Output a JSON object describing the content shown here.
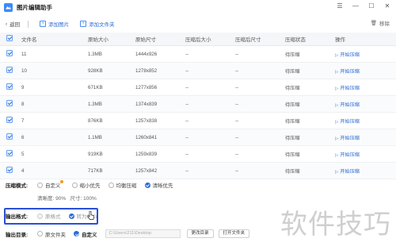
{
  "window": {
    "title": "图片编辑助手",
    "controls": [
      "☰",
      "—",
      "☐",
      "✕"
    ]
  },
  "toolbar": {
    "back_label": "返回",
    "add_image_label": "添加图片",
    "add_folder_label": "添加文件夹",
    "delete_label": "移除"
  },
  "table": {
    "headers": [
      "文件名",
      "原始大小",
      "原始尺寸",
      "压缩后大小",
      "压缩后尺寸",
      "压缩状态",
      "操作"
    ],
    "rows": [
      {
        "name": "11",
        "orig_size": "1.3MB",
        "orig_dim": "1444x926",
        "comp_size": "--",
        "comp_dim": "--",
        "status": "待压缩",
        "action": "开始压缩"
      },
      {
        "name": "10",
        "orig_size": "928KB",
        "orig_dim": "1278x852",
        "comp_size": "--",
        "comp_dim": "--",
        "status": "待压缩",
        "action": "开始压缩"
      },
      {
        "name": "9",
        "orig_size": "671KB",
        "orig_dim": "1277x856",
        "comp_size": "--",
        "comp_dim": "--",
        "status": "待压缩",
        "action": "开始压缩"
      },
      {
        "name": "8",
        "orig_size": "1.3MB",
        "orig_dim": "1374x839",
        "comp_size": "--",
        "comp_dim": "--",
        "status": "待压缩",
        "action": "开始压缩"
      },
      {
        "name": "7",
        "orig_size": "876KB",
        "orig_dim": "1257x838",
        "comp_size": "--",
        "comp_dim": "--",
        "status": "待压缩",
        "action": "开始压缩"
      },
      {
        "name": "6",
        "orig_size": "1.1MB",
        "orig_dim": "1260x841",
        "comp_size": "--",
        "comp_dim": "--",
        "status": "待压缩",
        "action": "开始压缩"
      },
      {
        "name": "5",
        "orig_size": "919KB",
        "orig_dim": "1259x839",
        "comp_size": "--",
        "comp_dim": "--",
        "status": "待压缩",
        "action": "开始压缩"
      },
      {
        "name": "4",
        "orig_size": "717KB",
        "orig_dim": "1257x842",
        "comp_size": "--",
        "comp_dim": "--",
        "status": "待压缩",
        "action": "开始压缩"
      }
    ]
  },
  "compress_mode": {
    "label": "压缩模式:",
    "options": [
      "自定义",
      "缩小优先",
      "均衡压缩",
      "清晰优先"
    ],
    "selected": "清晰优先",
    "info": "清晰度: 90%   尺寸: 100%"
  },
  "output_format": {
    "label": "输出格式:",
    "options": [
      "原格式",
      "转为JPG"
    ],
    "selected": "转为JPG"
  },
  "output_dir": {
    "label": "输出目录:",
    "options": [
      "原文件夹",
      "自定义"
    ],
    "selected": "自定义",
    "path_placeholder": "C:\\Users\\211\\Desktop",
    "change_button": "更改目录",
    "open_button": "打开文件夹"
  },
  "watermark": "软件技巧",
  "colors": {
    "accent": "#2b6bd6",
    "highlight_border": "#2a4fd8"
  }
}
